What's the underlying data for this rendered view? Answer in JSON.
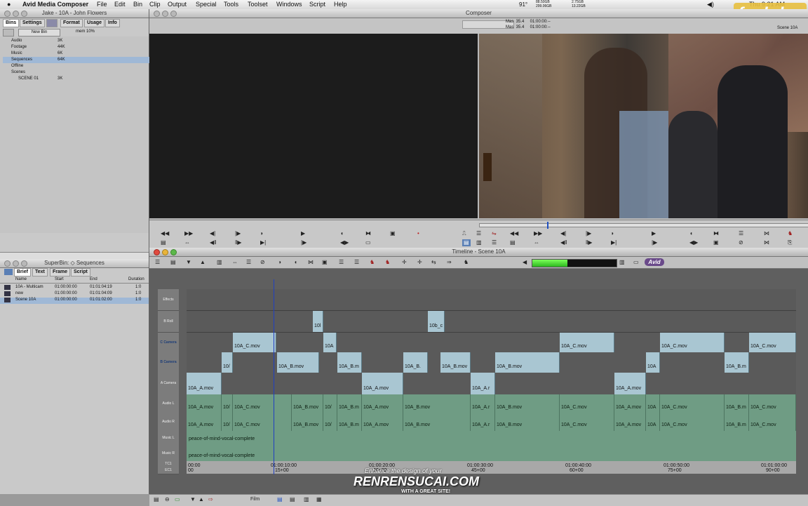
{
  "menubar": {
    "app": "Avid Media Composer",
    "items": [
      "File",
      "Edit",
      "Bin",
      "Clip",
      "Output",
      "Special",
      "Tools",
      "Toolset",
      "Windows",
      "Script",
      "Help"
    ],
    "status": {
      "temp": "91°",
      "mem1": "88.50GB",
      "mem2": "299.06GB",
      "mem3": "2.75GB",
      "mem4": "13.22GB",
      "clock": "Thu 9:21 AM"
    }
  },
  "project": {
    "title": "Jake - 10A - John Flowers",
    "tabs": [
      "Bins",
      "Settings",
      "",
      "Format",
      "Usage",
      "Info"
    ],
    "new_bin": "New Bin",
    "mem": "mem 10%",
    "bins": [
      {
        "name": "Audio",
        "size": "3K"
      },
      {
        "name": "Footage",
        "size": "44K"
      },
      {
        "name": "Music",
        "size": "6K"
      },
      {
        "name": "Sequences",
        "size": "64K"
      },
      {
        "name": "Offline",
        "size": ""
      },
      {
        "name": "Scenes",
        "size": ""
      },
      {
        "name": "SCENE 01",
        "size": "3K"
      }
    ]
  },
  "superbin": {
    "title": "SuperBin: ◇ Sequences",
    "tabs": [
      "Brief",
      "Text",
      "Frame",
      "Script"
    ],
    "headers": [
      "Name",
      "Start",
      "End",
      "Duration"
    ],
    "rows": [
      [
        "10A - Multicam",
        "01:00:00:00",
        "01:01:04:19",
        "1:0"
      ],
      [
        "new",
        "01:00:00:00",
        "01:01:04:09",
        "1:0"
      ],
      [
        "Scene 10A",
        "01:00:00:00",
        "01:01:02:00",
        "1:0"
      ]
    ]
  },
  "composer": {
    "title": "Composer",
    "mas1": "Mas  35.4     01:00:00:--",
    "mas2": "Mas  35.4     01:00:00:--",
    "seq_name": "Scene 10A"
  },
  "timeline": {
    "title": "Timeline - Scene 10A",
    "logo": "Avid",
    "tracks": [
      "Effects",
      "B Roll",
      "C Camera",
      "B Camera",
      "A Camera",
      "Audio L",
      "Audio R",
      "Music L",
      "Music R"
    ],
    "tc_labels": [
      "TC1",
      "EC1"
    ],
    "timecodes": [
      "00:00",
      "01:00:10:00",
      "01:00:20:00",
      "01:00:30:00",
      "01:00:40:00",
      "01:00:50:00",
      "01:01:00:00"
    ],
    "feet": [
      "00",
      "15+00",
      "30+00",
      "45+00",
      "60+00",
      "75+00",
      "90+00"
    ],
    "broll": [
      "10l",
      "10b_c"
    ],
    "ccam": [
      "10A_C.mov",
      "10A",
      "10A_C.mov",
      "10A_C.mov",
      "10A_C.mov"
    ],
    "bcam": [
      "10/",
      "10A_B.mov",
      "10A_B.m",
      "10A_B.",
      "10A_B.mov",
      "10A_B.mov",
      "10A",
      "10A_B.m"
    ],
    "acam": [
      "10A_A.mov",
      "10A_A.mov",
      "10A_A.r",
      "10A_A.mov"
    ],
    "audio": [
      "10A_A.mov",
      "10/",
      "10A_C.mov",
      "10A_B.mov",
      "10/",
      "10A_B.m",
      "10A_A.mov",
      "10A_B.mov",
      "10A_A.r",
      "10A_B.mov",
      "10A_C.mov",
      "10A_A.mov",
      "10A",
      "10A_C.mov",
      "10A_B.m",
      "10A_C.mov"
    ],
    "music": "peace-of-mind-vocal-complete",
    "bottom_label": "Film"
  },
  "watermark": {
    "logo": "fxphd",
    "site": "RENRENSUCAI.COM",
    "tagline": "Enhance the design of your",
    "sub": "WITH A GREAT SITE!"
  }
}
